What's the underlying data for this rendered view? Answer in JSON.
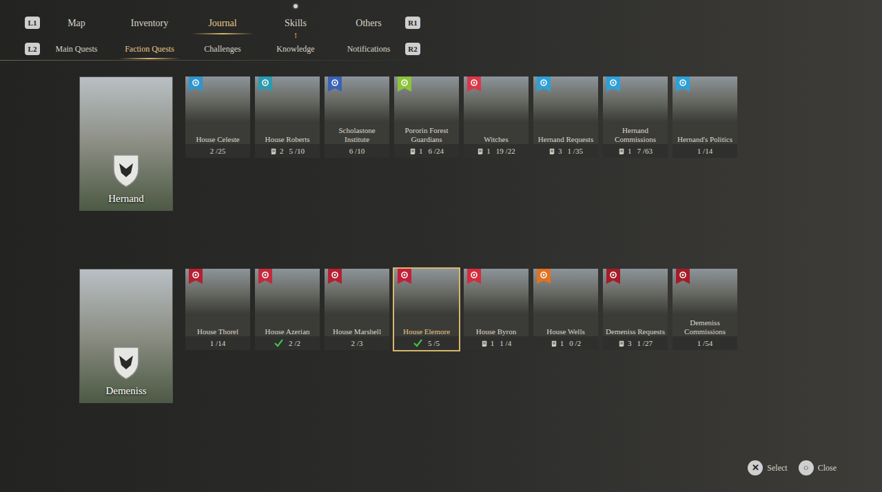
{
  "nav": {
    "left_key": "L1",
    "right_key": "R1",
    "tabs": [
      {
        "label": "Map",
        "selected": false,
        "notice": false
      },
      {
        "label": "Inventory",
        "selected": false,
        "notice": false
      },
      {
        "label": "Journal",
        "selected": true,
        "notice": false
      },
      {
        "label": "Skills",
        "selected": false,
        "notice": true
      },
      {
        "label": "Others",
        "selected": false,
        "notice": false
      }
    ]
  },
  "subnav": {
    "left_key": "L2",
    "right_key": "R2",
    "tabs": [
      {
        "label": "Main Quests",
        "selected": false,
        "notice": ""
      },
      {
        "label": "Faction Quests",
        "selected": true,
        "notice": ""
      },
      {
        "label": "Challenges",
        "selected": false,
        "notice": ""
      },
      {
        "label": "Knowledge",
        "selected": false,
        "notice": "!"
      },
      {
        "label": "Notifications",
        "selected": false,
        "notice": ""
      }
    ]
  },
  "regions": [
    {
      "name": "Hernand",
      "factions": [
        {
          "title": "House Celeste",
          "count": "",
          "progress": "2 /25",
          "completed": false,
          "selected": false,
          "color": "#2f95cf"
        },
        {
          "title": "House Roberts",
          "count": "2",
          "progress": "5 /10",
          "completed": false,
          "selected": false,
          "color": "#2a9bb0"
        },
        {
          "title": "Scholastone Institute",
          "count": "",
          "progress": "6 /10",
          "completed": false,
          "selected": false,
          "color": "#3a62b5"
        },
        {
          "title": "Pororin Forest Guardians",
          "count": "1",
          "progress": "6 /24",
          "completed": false,
          "selected": false,
          "color": "#8cc43c"
        },
        {
          "title": "Witches",
          "count": "1",
          "progress": "19 /22",
          "completed": false,
          "selected": false,
          "color": "#d9384a"
        },
        {
          "title": "Hernand Requests",
          "count": "3",
          "progress": "1 /35",
          "completed": false,
          "selected": false,
          "color": "#2ea0d8"
        },
        {
          "title": "Hernand Commissions",
          "count": "1",
          "progress": "7 /63",
          "completed": false,
          "selected": false,
          "color": "#2ea0d8"
        },
        {
          "title": "Hernand's Politics",
          "count": "",
          "progress": "1 /14",
          "completed": false,
          "selected": false,
          "color": "#2ea0d8"
        }
      ]
    },
    {
      "name": "Demeniss",
      "factions": [
        {
          "title": "House Thorel",
          "count": "",
          "progress": "1 /14",
          "completed": false,
          "selected": false,
          "color": "#b52030"
        },
        {
          "title": "House Azerian",
          "count": "",
          "progress": "2 /2",
          "completed": true,
          "selected": false,
          "color": "#c42a3c"
        },
        {
          "title": "House Marshell",
          "count": "",
          "progress": "2 /3",
          "completed": false,
          "selected": false,
          "color": "#b52032"
        },
        {
          "title": "House Elemore",
          "count": "",
          "progress": "5 /5",
          "completed": true,
          "selected": true,
          "color": "#c41e3a"
        },
        {
          "title": "House Byron",
          "count": "1",
          "progress": "1 /4",
          "completed": false,
          "selected": false,
          "color": "#d42c3c"
        },
        {
          "title": "House Wells",
          "count": "1",
          "progress": "0 /2",
          "completed": false,
          "selected": false,
          "color": "#e27222"
        },
        {
          "title": "Demeniss Requests",
          "count": "3",
          "progress": "1 /27",
          "completed": false,
          "selected": false,
          "color": "#a51c28"
        },
        {
          "title": "Demeniss Commissions",
          "count": "",
          "progress": "1 /54",
          "completed": false,
          "selected": false,
          "color": "#a51c28"
        }
      ]
    }
  ],
  "footer": {
    "buttons": [
      {
        "key": "✕",
        "label": "Select"
      },
      {
        "key": "○",
        "label": "Close"
      }
    ]
  }
}
